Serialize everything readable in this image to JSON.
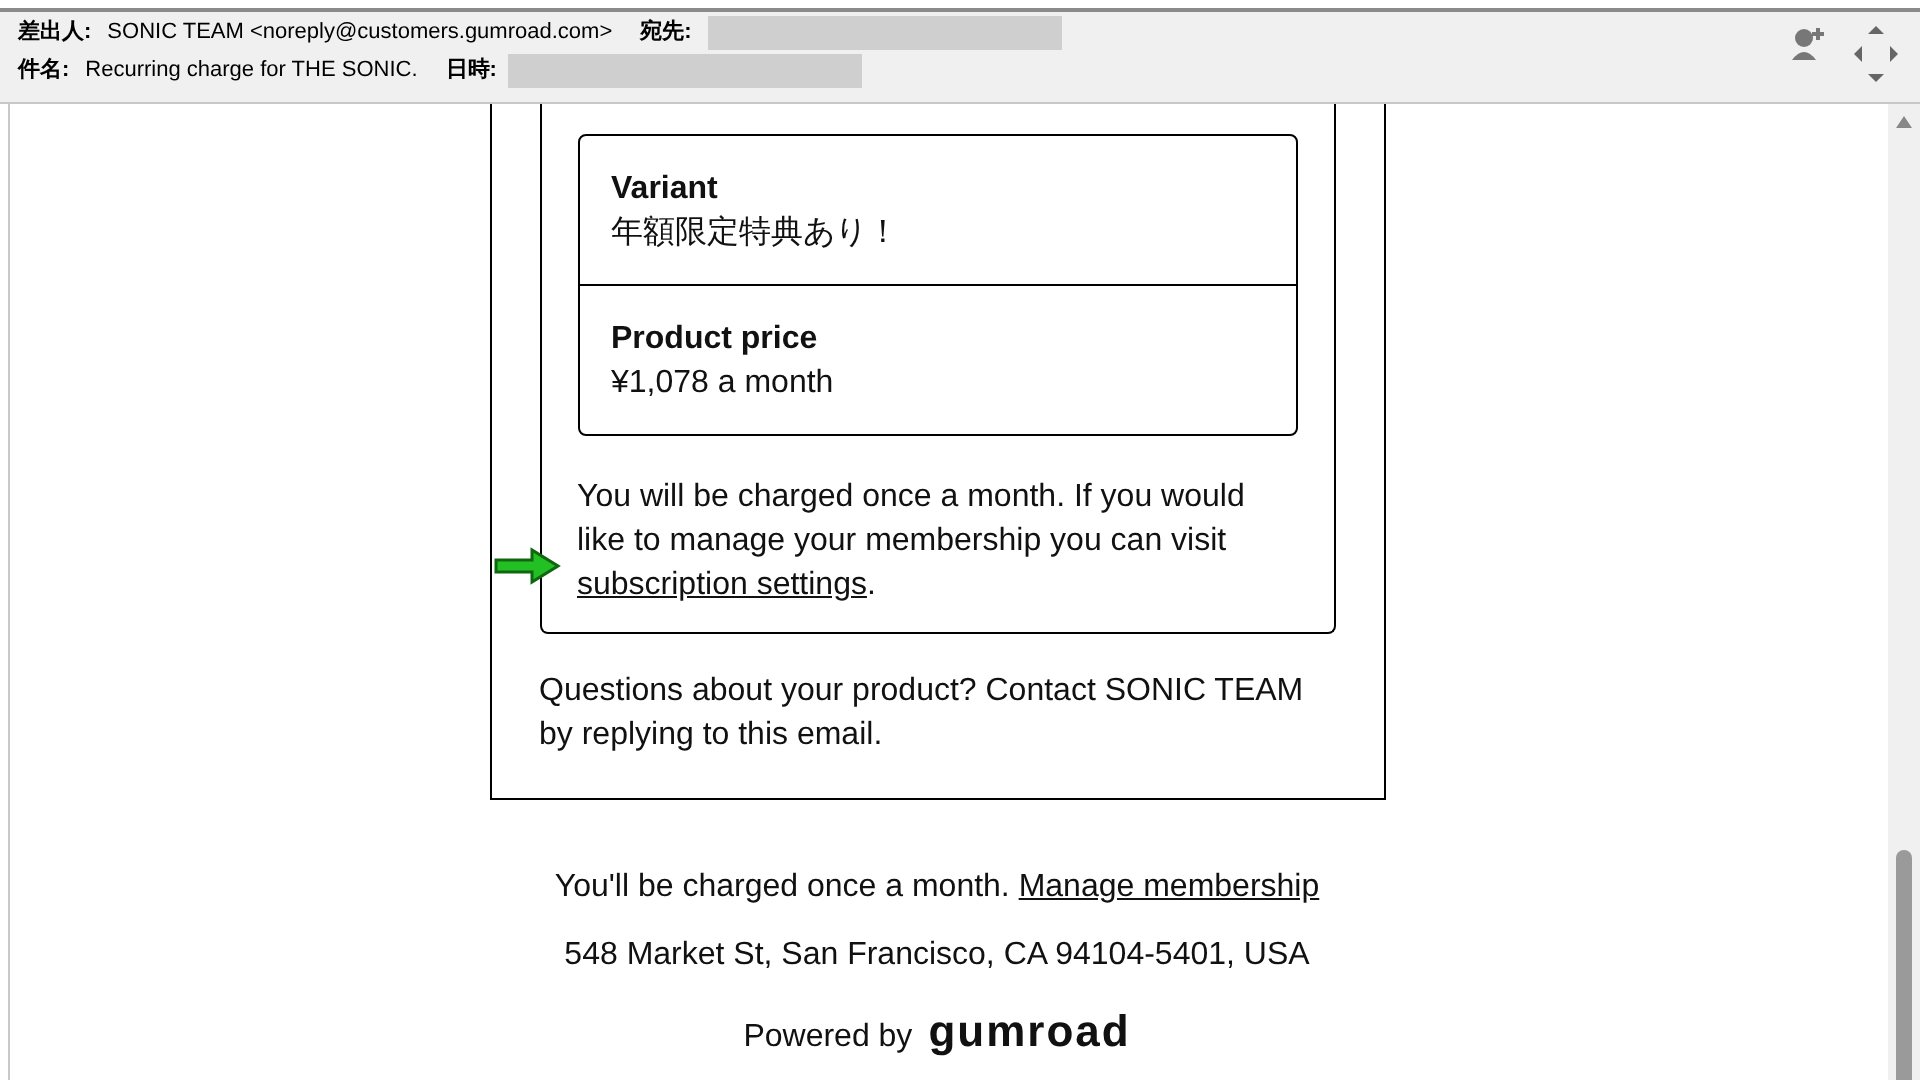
{
  "header": {
    "from_label": "差出人:",
    "from": "SONIC TEAM <noreply@customers.gumroad.com>",
    "to_label": "宛先:",
    "subject_label": "件名:",
    "subject": "Recurring charge for THE SONIC.",
    "date_label": "日時:"
  },
  "details": [
    {
      "label": "Variant",
      "value": "年額限定特典あり！"
    },
    {
      "label": "Product price",
      "value": "¥1,078 a month"
    }
  ],
  "notice": {
    "text": "You will be charged once a month. If you would like to manage your membership you can visit",
    "link": "subscription settings",
    "end": "."
  },
  "questions": "Questions about your product? Contact SONIC TEAM by replying to this email.",
  "footer": {
    "text": "You'll be charged once a month.",
    "link": "Manage membership",
    "address": "548 Market St, San Francisco, CA 94104-5401, USA",
    "powered": "Powered by",
    "logo": "gumroad"
  }
}
